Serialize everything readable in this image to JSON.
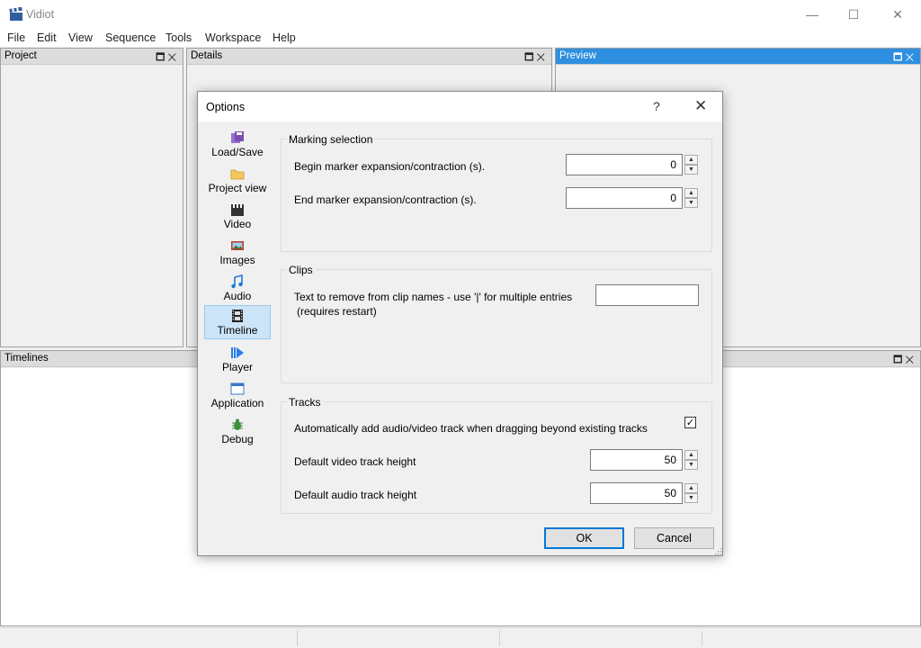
{
  "window": {
    "title": "Vidiot",
    "minimize": "—",
    "maximize": "☐",
    "close": "✕"
  },
  "menubar": [
    "File",
    "Edit",
    "View",
    "Sequence",
    "Tools",
    "Workspace",
    "Help"
  ],
  "panels": {
    "project": {
      "title": "Project",
      "buttons": "🗖✕"
    },
    "details": {
      "title": "Details",
      "buttons": "🗖✕"
    },
    "preview": {
      "title": "Preview",
      "buttons": "🗖✕"
    },
    "timelines": {
      "title": "Timelines",
      "buttons": "🗖✕"
    }
  },
  "dialog": {
    "title": "Options",
    "help": "?",
    "close": "✕",
    "categories": [
      {
        "label": "Load/Save",
        "icon": "floppy-disk-icon",
        "color": "#7a4fb0"
      },
      {
        "label": "Project view",
        "icon": "folder-icon",
        "color": "#e8b84a"
      },
      {
        "label": "Video",
        "icon": "clapperboard-icon",
        "color": "#333333"
      },
      {
        "label": "Images",
        "icon": "picture-icon",
        "color": "#c0392b"
      },
      {
        "label": "Audio",
        "icon": "music-note-icon",
        "color": "#1e7bd6"
      },
      {
        "label": "Timeline",
        "icon": "film-icon",
        "color": "#222222",
        "selected": true
      },
      {
        "label": "Player",
        "icon": "play-icon",
        "color": "#2b7de9"
      },
      {
        "label": "Application",
        "icon": "window-icon",
        "color": "#3a78c9"
      },
      {
        "label": "Debug",
        "icon": "bug-icon",
        "color": "#3e8e3e"
      }
    ],
    "marking": {
      "title": "Marking selection",
      "begin_label": "Begin marker expansion/contraction (s).",
      "begin_value": "0",
      "end_label": "End marker expansion/contraction (s).",
      "end_value": "0"
    },
    "clips": {
      "title": "Clips",
      "remove_label": "Text to remove from clip names - use '|' for multiple entries",
      "remove_note": "(requires restart)",
      "remove_value": ""
    },
    "tracks": {
      "title": "Tracks",
      "auto_add_label": "Automatically add audio/video track when dragging beyond existing tracks",
      "auto_add_checked": "✓",
      "video_height_label": "Default video track height",
      "video_height_value": "50",
      "audio_height_label": "Default audio track height",
      "audio_height_value": "50"
    },
    "ok_label": "OK",
    "cancel_label": "Cancel"
  }
}
